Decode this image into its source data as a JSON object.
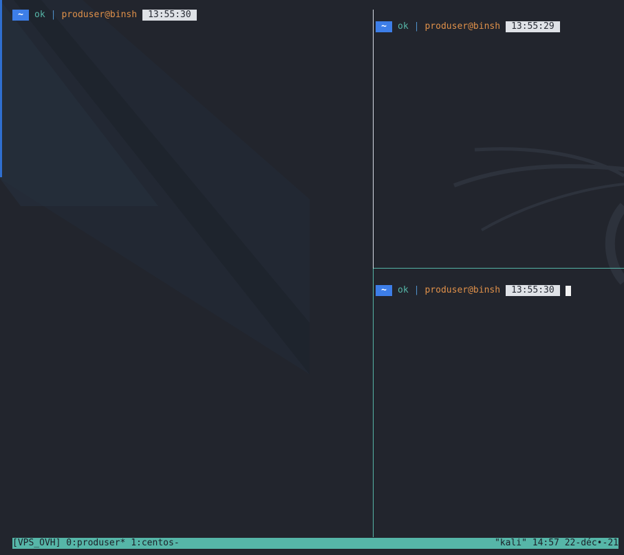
{
  "panes": {
    "left": {
      "tilde": "~",
      "status": "ok",
      "separator": "|",
      "user_host": "produser@binsh",
      "time": "13:55:30"
    },
    "top_right": {
      "tilde": "~",
      "status": "ok",
      "separator": "|",
      "user_host": "produser@binsh",
      "time": "13:55:29"
    },
    "bottom_right": {
      "tilde": "~",
      "status": "ok",
      "separator": "|",
      "user_host": "produser@binsh",
      "time": "13:55:30"
    }
  },
  "status_bar": {
    "session": "[VPS_OVH]",
    "window_0": "0:produser*",
    "window_1": "1:centos-",
    "host": "\"kali\"",
    "time": "14:57",
    "date": "22-déc•-21"
  },
  "colors": {
    "background": "#22252d",
    "accent_teal": "#56b6a8",
    "tilde_blue": "#3d7ee8",
    "user_orange": "#e0914a",
    "time_bg": "#dfe2e7"
  }
}
